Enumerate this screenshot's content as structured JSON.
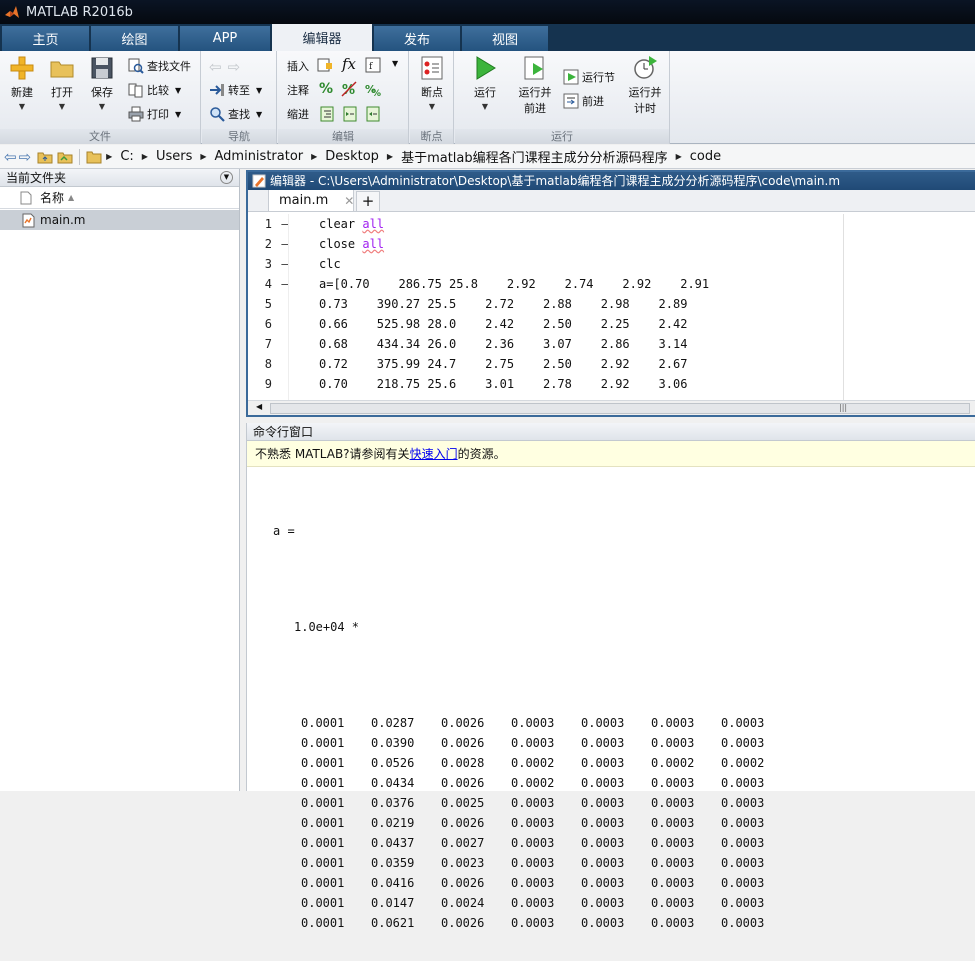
{
  "window": {
    "title": "MATLAB R2016b"
  },
  "tabs": [
    {
      "label": "主页"
    },
    {
      "label": "绘图"
    },
    {
      "label": "APP"
    },
    {
      "label": "编辑器"
    },
    {
      "label": "发布"
    },
    {
      "label": "视图"
    }
  ],
  "ribbon": {
    "file": {
      "label": "文件",
      "new": "新建",
      "open": "打开",
      "save": "保存",
      "find_files": "查找文件",
      "compare": "比较",
      "print": "打印"
    },
    "nav": {
      "label": "导航",
      "goto": "转至",
      "find": "查找"
    },
    "edit": {
      "label": "编辑",
      "insert": "插入",
      "comment": "注释",
      "indent": "缩进"
    },
    "breakpoints": {
      "label": "断点",
      "button": "断点"
    },
    "run": {
      "label": "运行",
      "run": "运行",
      "run_advance_1": "运行并",
      "run_advance_2": "前进",
      "run_section": "运行节",
      "advance": "前进",
      "run_time_1": "运行并",
      "run_time_2": "计时"
    }
  },
  "address": {
    "crumbs": [
      "C:",
      "Users",
      "Administrator",
      "Desktop",
      "基于matlab编程各门课程主成分分析源码程序",
      "code"
    ]
  },
  "current_folder": {
    "title": "当前文件夹",
    "column_name": "名称",
    "files": [
      "main.m"
    ]
  },
  "editor": {
    "title": "编辑器 - C:\\Users\\Administrator\\Desktop\\基于matlab编程各门课程主成分分析源码程序\\code\\main.m",
    "tab": "main.m",
    "lines": [
      {
        "n": "1",
        "dash": "–",
        "pre": "clear ",
        "kw": "all",
        "post": ""
      },
      {
        "n": "2",
        "dash": "–",
        "pre": "close ",
        "kw": "all",
        "post": ""
      },
      {
        "n": "3",
        "dash": "–",
        "pre": "clc",
        "kw": "",
        "post": ""
      },
      {
        "n": "4",
        "dash": "–",
        "pre": "a=[0.70    286.75 25.8    2.92    2.74    2.92    2.91",
        "kw": "",
        "post": ""
      },
      {
        "n": "5",
        "dash": "",
        "pre": "0.73    390.27 25.5    2.72    2.88    2.98    2.89",
        "kw": "",
        "post": ""
      },
      {
        "n": "6",
        "dash": "",
        "pre": "0.66    525.98 28.0    2.42    2.50    2.25    2.42",
        "kw": "",
        "post": ""
      },
      {
        "n": "7",
        "dash": "",
        "pre": "0.68    434.34 26.0    2.36    3.07    2.86    3.14",
        "kw": "",
        "post": ""
      },
      {
        "n": "8",
        "dash": "",
        "pre": "0.72    375.99 24.7    2.75    2.50    2.92    2.67",
        "kw": "",
        "post": ""
      },
      {
        "n": "9",
        "dash": "",
        "pre": "0.70    218.75 25.6    3.01    2.78    2.92    3.06",
        "kw": "",
        "post": ""
      }
    ]
  },
  "command_window": {
    "title": "命令行窗口",
    "tip_pre": "不熟悉 MATLAB?请参阅有关",
    "tip_link": "快速入门",
    "tip_post": "的资源。",
    "var_line": "a =",
    "scale_line": "1.0e+04 *",
    "rows": [
      [
        "0.0001",
        "0.0287",
        "0.0026",
        "0.0003",
        "0.0003",
        "0.0003",
        "0.0003"
      ],
      [
        "0.0001",
        "0.0390",
        "0.0026",
        "0.0003",
        "0.0003",
        "0.0003",
        "0.0003"
      ],
      [
        "0.0001",
        "0.0526",
        "0.0028",
        "0.0002",
        "0.0003",
        "0.0002",
        "0.0002"
      ],
      [
        "0.0001",
        "0.0434",
        "0.0026",
        "0.0002",
        "0.0003",
        "0.0003",
        "0.0003"
      ],
      [
        "0.0001",
        "0.0376",
        "0.0025",
        "0.0003",
        "0.0003",
        "0.0003",
        "0.0003"
      ],
      [
        "0.0001",
        "0.0219",
        "0.0026",
        "0.0003",
        "0.0003",
        "0.0003",
        "0.0003"
      ],
      [
        "0.0001",
        "0.0437",
        "0.0027",
        "0.0003",
        "0.0003",
        "0.0003",
        "0.0003"
      ],
      [
        "0.0001",
        "0.0359",
        "0.0023",
        "0.0003",
        "0.0003",
        "0.0003",
        "0.0003"
      ],
      [
        "0.0001",
        "0.0416",
        "0.0026",
        "0.0003",
        "0.0003",
        "0.0003",
        "0.0003"
      ],
      [
        "0.0001",
        "0.0147",
        "0.0024",
        "0.0003",
        "0.0003",
        "0.0003",
        "0.0003"
      ],
      [
        "0.0001",
        "0.0621",
        "0.0026",
        "0.0003",
        "0.0003",
        "0.0003",
        "0.0003"
      ]
    ]
  },
  "colors": {
    "keyword": "#a020f0",
    "tip_bg": "#ffffe1",
    "active_tab": "#eef1f5"
  }
}
